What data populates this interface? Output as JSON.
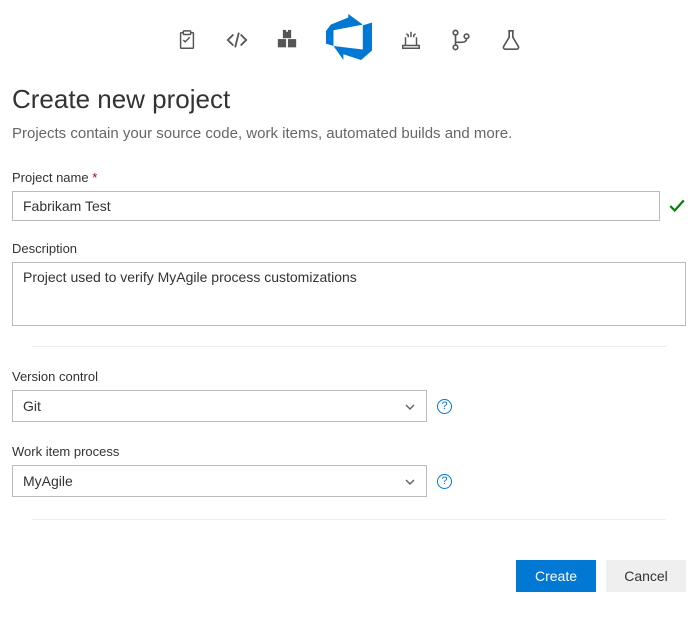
{
  "header": {
    "title": "Create new project",
    "subtitle": "Projects contain your source code, work items, automated builds and more."
  },
  "icons": {
    "work": "work-items-icon",
    "code": "code-icon",
    "packages": "packages-icon",
    "devops": "azure-devops-icon",
    "builds": "builds-icon",
    "repos": "repos-icon",
    "tests": "tests-icon"
  },
  "fields": {
    "project_name": {
      "label": "Project name",
      "required_marker": "*",
      "value": "Fabrikam Test",
      "valid": true
    },
    "description": {
      "label": "Description",
      "value_plain": "Project used to verify MyAgile process customizations",
      "value_parts": [
        "Project used to verify ",
        "MyAgile",
        " process ",
        "customizations"
      ]
    },
    "version_control": {
      "label": "Version control",
      "selected": "Git"
    },
    "work_item_process": {
      "label": "Work item process",
      "selected": "MyAgile"
    }
  },
  "footer": {
    "create_label": "Create",
    "cancel_label": "Cancel"
  }
}
